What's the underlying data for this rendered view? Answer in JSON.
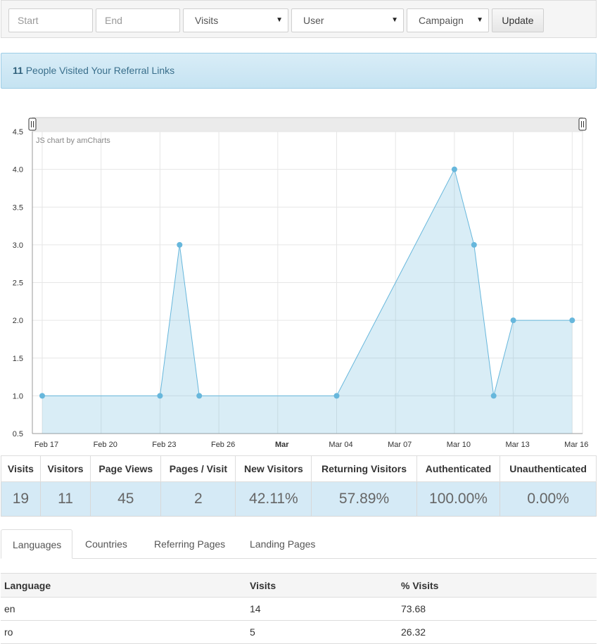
{
  "filters": {
    "start_placeholder": "Start",
    "end_placeholder": "End",
    "metric_select": "Visits",
    "user_select": "User",
    "campaign_select": "Campaign",
    "update_label": "Update"
  },
  "banner": {
    "count": "11",
    "text": "People Visited Your Referral Links"
  },
  "chart_data": {
    "type": "area",
    "credit": "JS chart by amCharts",
    "x_ticks": [
      "Feb 17",
      "Feb 20",
      "Feb 23",
      "Feb 26",
      "Mar",
      "Mar 04",
      "Mar 07",
      "Mar 10",
      "Mar 13",
      "Mar 16"
    ],
    "y_ticks": [
      "0.5",
      "1.0",
      "1.5",
      "2.0",
      "2.5",
      "3.0",
      "3.5",
      "4.0",
      "4.5"
    ],
    "ylim": [
      0.5,
      4.5
    ],
    "grid": true,
    "color": "#67b7dc",
    "x": [
      "Feb 17",
      "Feb 23",
      "Feb 24",
      "Feb 25",
      "Mar 04",
      "Mar 10",
      "Mar 11",
      "Mar 12",
      "Mar 13",
      "Mar 16"
    ],
    "values": [
      1,
      1,
      3,
      1,
      1,
      4,
      3,
      1,
      2,
      2
    ]
  },
  "summary": {
    "headers": [
      "Visits",
      "Visitors",
      "Page Views",
      "Pages / Visit",
      "New Visitors",
      "Returning Visitors",
      "Authenticated",
      "Unauthenticated"
    ],
    "values": [
      "19",
      "11",
      "45",
      "2",
      "42.11%",
      "57.89%",
      "100.00%",
      "0.00%"
    ]
  },
  "tabs": [
    "Languages",
    "Countries",
    "Referring Pages",
    "Landing Pages"
  ],
  "languages": {
    "headers": [
      "Language",
      "Visits",
      "% Visits"
    ],
    "rows": [
      [
        "en",
        "14",
        "73.68"
      ],
      [
        "ro",
        "5",
        "26.32"
      ]
    ]
  }
}
